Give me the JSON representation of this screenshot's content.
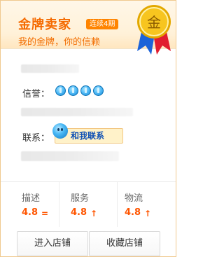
{
  "header": {
    "title": "金牌卖家",
    "streak_badge": "连续4期",
    "subtitle": "我的金牌，你的信赖",
    "medal_char": "金",
    "medal_colors": {
      "gold": "#f7c51f",
      "ribbon_blue": "#1c63d8",
      "ribbon_red": "#e11d2f"
    }
  },
  "profile": {
    "reputation_label": "信誉：",
    "reputation_icons": [
      "crown-icon",
      "crown-icon",
      "crown-icon",
      "crown-icon"
    ],
    "contact_label": "联系：",
    "contact_button": "和我联系"
  },
  "stats": [
    {
      "label": "描述",
      "value": "4.8",
      "trend": "="
    },
    {
      "label": "服务",
      "value": "4.8",
      "trend": "↑"
    },
    {
      "label": "物流",
      "value": "4.8",
      "trend": "↑"
    }
  ],
  "actions": {
    "enter_store": "进入店铺",
    "favorite_store": "收藏店铺"
  }
}
